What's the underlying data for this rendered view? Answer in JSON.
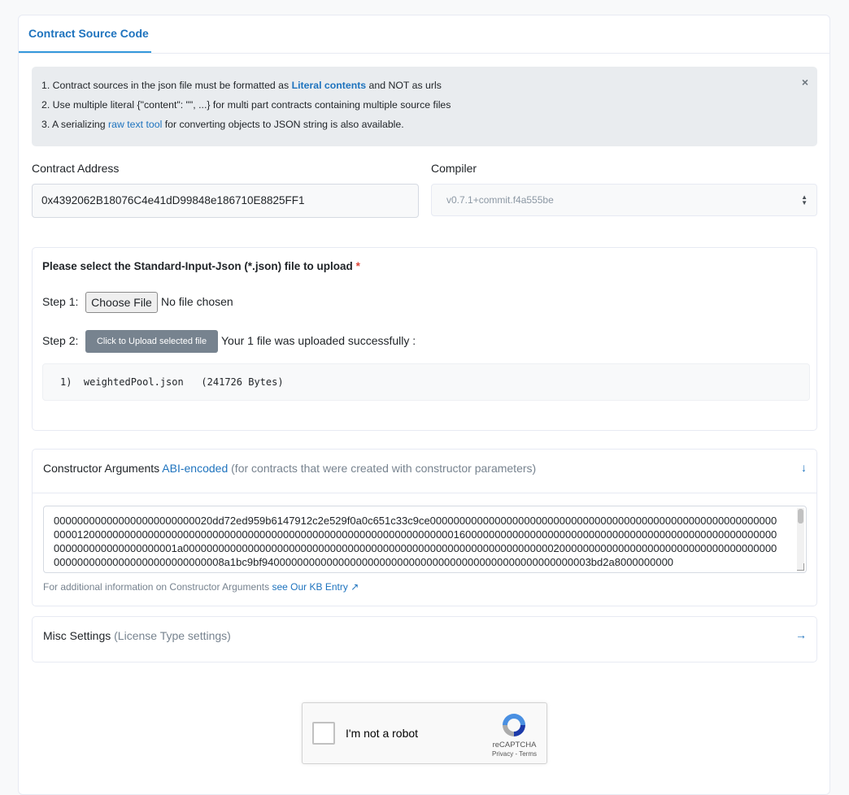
{
  "tabs": {
    "active_label": "Contract Source Code"
  },
  "alert": {
    "line1_pre": "1. Contract sources in the json file must be formatted as ",
    "line1_link": "Literal contents",
    "line1_post": " and NOT as urls",
    "line2": "2. Use multiple literal {\"content\": \"\", ...} for multi part contracts containing multiple source files",
    "line3_pre": "3. A serializing ",
    "line3_link": "raw text tool",
    "line3_post": " for converting objects to JSON string is also available.",
    "close": "×"
  },
  "contract_address": {
    "label": "Contract Address",
    "value": "0x4392062B18076C4e41dD99848e186710E8825FF1"
  },
  "compiler": {
    "label": "Compiler",
    "selected": "v0.7.1+commit.f4a555be"
  },
  "upload": {
    "title": "Please select the Standard-Input-Json (*.json) file to upload",
    "required_mark": "*",
    "step1_label": "Step 1:",
    "choose_button": "Choose File",
    "no_file": "No file chosen",
    "step2_label": "Step 2:",
    "upload_button": "Click to Upload selected file",
    "status": "Your 1 file was uploaded successfully :",
    "files": [
      {
        "index": "1)",
        "name": "weightedPool.json",
        "size": "(241726 Bytes)"
      }
    ]
  },
  "constructor": {
    "title": "Constructor Arguments",
    "title_link": "ABI-encoded",
    "title_note": "(for contracts that were created with constructor parameters)",
    "value": "000000000000000000000000020dd72ed959b6147912c2e529f0a0c651c33c9ce00000000000000000000000000000000000000000000000000000000000000012000000000000000000000000000000000000000000000000000000000000001600000000000000000000000000000000000000000000000000000000000000000000000001a0000000000000000000000000000000000000000000000000000000000000002000000000000000000000000000000000000000000000000000000000000000008a1bc9bf94000000000000000000000000000000000000000000000000000003bd2a8000000000",
    "note": "For additional information on Constructor Arguments ",
    "note_link": "see Our KB Entry"
  },
  "misc": {
    "title": "Misc Settings",
    "note": "(License Type settings)"
  },
  "captcha": {
    "label": "I'm not a robot",
    "brand": "reCAPTCHA",
    "terms": "Privacy - Terms"
  },
  "colors": {
    "accent": "#1e73be",
    "required": "#de4437",
    "muted": "#77838f",
    "alert_bg": "#e9ecef"
  }
}
